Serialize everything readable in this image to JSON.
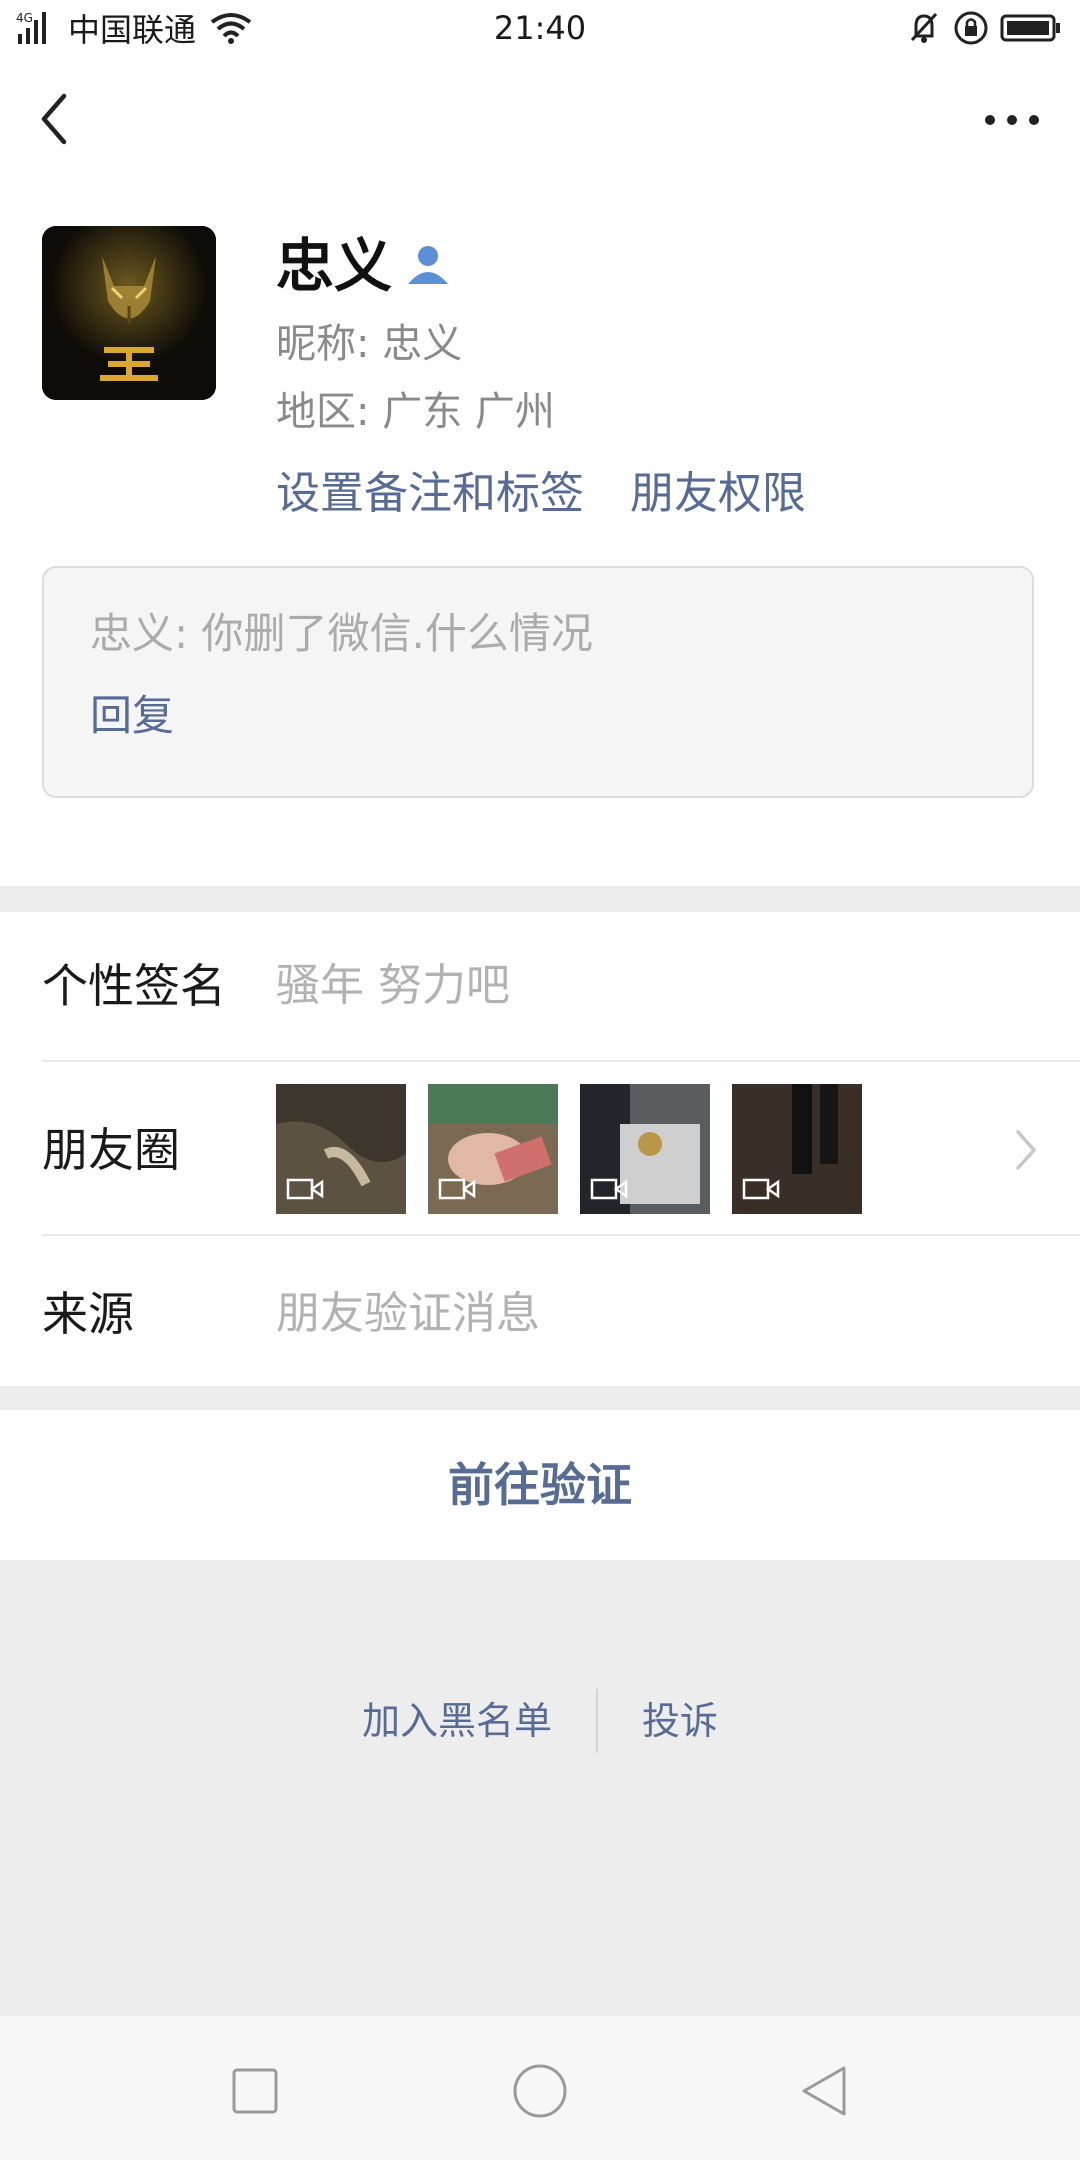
{
  "status_bar": {
    "network": "4G",
    "carrier": "中国联通",
    "time": "21:40"
  },
  "header": {
    "back_icon": "back-chevron-icon",
    "more_icon": "more-dots-icon"
  },
  "profile": {
    "name": "忠义",
    "nickname_line": "昵称:  忠义",
    "region_line": "地区:  广东  广州",
    "set_remark_link": "设置备注和标签",
    "friend_permission_link": "朋友权限"
  },
  "message": {
    "text": "忠义: 你删了微信.什么情况",
    "reply_label": "回复"
  },
  "details": {
    "signature_label": "个性签名",
    "signature_value": "骚年 努力吧",
    "moments_label": "朋友圈",
    "moments_thumbs": [
      {
        "icon": "video-icon"
      },
      {
        "icon": "video-icon"
      },
      {
        "icon": "video-icon"
      },
      {
        "icon": "video-icon"
      }
    ],
    "source_label": "来源",
    "source_value": "朋友验证消息"
  },
  "actions": {
    "verify_button": "前往验证",
    "blacklist_link": "加入黑名单",
    "report_link": "投诉"
  },
  "colors": {
    "link": "#576b95",
    "page_bg": "#ededed",
    "card_bg": "#ffffff"
  }
}
